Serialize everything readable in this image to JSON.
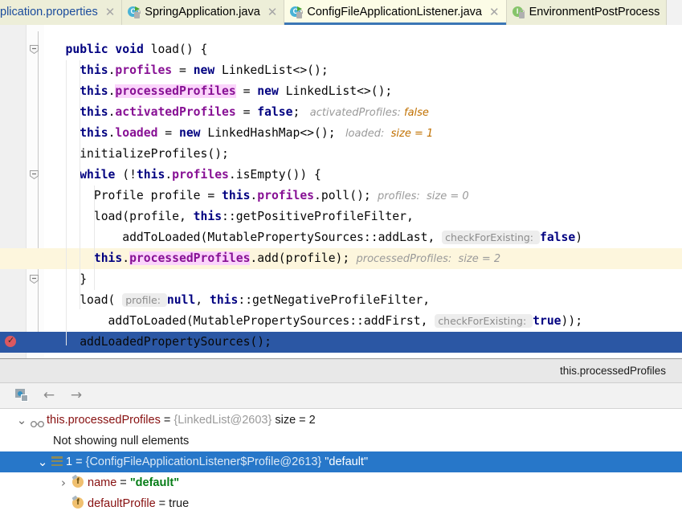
{
  "tabs": [
    {
      "label": "plication.properties",
      "icon": "properties-file-icon",
      "active": false,
      "modified": true,
      "partial": true
    },
    {
      "label": "SpringApplication.java",
      "icon": "java-class-icon",
      "active": false
    },
    {
      "label": "ConfigFileApplicationListener.java",
      "icon": "java-class-icon",
      "active": true
    },
    {
      "label": "EnvironmentPostProcess",
      "icon": "java-interface-icon",
      "active": false
    }
  ],
  "tab_close_glyph": "✕",
  "editor": {
    "lines": [
      {
        "indent": 3,
        "state": "normal",
        "tokens": [
          {
            "t": "kw",
            "v": "public"
          },
          {
            "t": "pln",
            "v": " "
          },
          {
            "t": "kw",
            "v": "void"
          },
          {
            "t": "pln",
            "v": " load() {"
          }
        ]
      },
      {
        "indent": 5,
        "state": "normal",
        "tokens": [
          {
            "t": "kw",
            "v": "this"
          },
          {
            "t": "pln",
            "v": "."
          },
          {
            "t": "fld",
            "v": "profiles"
          },
          {
            "t": "pln",
            "v": " = "
          },
          {
            "t": "kw",
            "v": "new"
          },
          {
            "t": "pln",
            "v": " LinkedList<>();"
          }
        ]
      },
      {
        "indent": 5,
        "state": "normal",
        "tokens": [
          {
            "t": "kw",
            "v": "this"
          },
          {
            "t": "pln",
            "v": "."
          },
          {
            "t": "fld-hl",
            "v": "processedProfiles"
          },
          {
            "t": "pln",
            "v": " = "
          },
          {
            "t": "kw",
            "v": "new"
          },
          {
            "t": "pln",
            "v": " LinkedList<>();"
          }
        ]
      },
      {
        "indent": 5,
        "state": "normal",
        "tokens": [
          {
            "t": "kw",
            "v": "this"
          },
          {
            "t": "pln",
            "v": "."
          },
          {
            "t": "fld",
            "v": "activatedProfiles"
          },
          {
            "t": "pln",
            "v": " = "
          },
          {
            "t": "kw",
            "v": "false"
          },
          {
            "t": "pln",
            "v": ";"
          },
          {
            "t": "hint",
            "v": "   activatedProfiles: "
          },
          {
            "t": "hintv",
            "v": "false"
          }
        ]
      },
      {
        "indent": 5,
        "state": "normal",
        "tokens": [
          {
            "t": "kw",
            "v": "this"
          },
          {
            "t": "pln",
            "v": "."
          },
          {
            "t": "fld",
            "v": "loaded"
          },
          {
            "t": "pln",
            "v": " = "
          },
          {
            "t": "kw",
            "v": "new"
          },
          {
            "t": "pln",
            "v": " LinkedHashMap<>();"
          },
          {
            "t": "hint",
            "v": "   loaded:  "
          },
          {
            "t": "hintv",
            "v": "size = 1"
          }
        ]
      },
      {
        "indent": 5,
        "state": "normal",
        "tokens": [
          {
            "t": "pln",
            "v": "initializeProfiles();"
          }
        ]
      },
      {
        "indent": 5,
        "state": "normal",
        "tokens": [
          {
            "t": "kw",
            "v": "while"
          },
          {
            "t": "pln",
            "v": " (!"
          },
          {
            "t": "kw",
            "v": "this"
          },
          {
            "t": "pln",
            "v": "."
          },
          {
            "t": "fld",
            "v": "profiles"
          },
          {
            "t": "pln",
            "v": ".isEmpty()) {"
          }
        ]
      },
      {
        "indent": 7,
        "state": "normal",
        "tokens": [
          {
            "t": "pln",
            "v": "Profile profile = "
          },
          {
            "t": "kw",
            "v": "this"
          },
          {
            "t": "pln",
            "v": "."
          },
          {
            "t": "fld",
            "v": "profiles"
          },
          {
            "t": "pln",
            "v": ".poll();"
          },
          {
            "t": "hint",
            "v": "  profiles:  "
          },
          {
            "t": "hintg",
            "v": "size = 0"
          }
        ]
      },
      {
        "indent": 7,
        "state": "normal",
        "tokens": [
          {
            "t": "pln",
            "v": "load(profile, "
          },
          {
            "t": "kw",
            "v": "this"
          },
          {
            "t": "pln",
            "v": "::getPositiveProfileFilter,"
          }
        ]
      },
      {
        "indent": 11,
        "state": "normal",
        "tokens": [
          {
            "t": "pln",
            "v": "addToLoaded(MutablePropertySources::addLast, "
          },
          {
            "t": "pbox",
            "v": "checkForExisting: ",
            "bval": "false"
          },
          {
            "t": "pln",
            "v": ")"
          }
        ]
      },
      {
        "indent": 7,
        "state": "highlight",
        "tokens": [
          {
            "t": "kw",
            "v": "this"
          },
          {
            "t": "pln",
            "v": "."
          },
          {
            "t": "fld-hl2",
            "v": "processedProfiles"
          },
          {
            "t": "pln",
            "v": ".add(profile);"
          },
          {
            "t": "hint",
            "v": "  processedProfiles:  "
          },
          {
            "t": "hintg",
            "v": "size = 2"
          }
        ]
      },
      {
        "indent": 5,
        "state": "normal",
        "tokens": [
          {
            "t": "pln",
            "v": "}"
          }
        ]
      },
      {
        "indent": 5,
        "state": "normal",
        "tokens": [
          {
            "t": "pln",
            "v": "load( "
          },
          {
            "t": "pbox2",
            "v": "profile: "
          },
          {
            "t": "kw",
            "v": "null"
          },
          {
            "t": "pln",
            "v": ", "
          },
          {
            "t": "kw",
            "v": "this"
          },
          {
            "t": "pln",
            "v": "::getNegativeProfileFilter,"
          }
        ]
      },
      {
        "indent": 9,
        "state": "normal",
        "tokens": [
          {
            "t": "pln",
            "v": "addToLoaded(MutablePropertySources::addFirst, "
          },
          {
            "t": "pbox",
            "v": "checkForExisting: ",
            "bval": "true"
          },
          {
            "t": "pln",
            "v": "));"
          }
        ]
      },
      {
        "indent": 5,
        "state": "exec",
        "tokens": [
          {
            "t": "pln",
            "v": "addLoadedPropertySources();"
          }
        ]
      }
    ],
    "fold_markers": [
      {
        "line": 0,
        "type": "fold-collapse"
      },
      {
        "line": 6,
        "type": "fold-collapse"
      },
      {
        "line": 11,
        "type": "fold-end"
      }
    ],
    "breakpoint": {
      "line": 14,
      "icon": "breakpoint-verified-icon"
    }
  },
  "popup": {
    "title": "this.processedProfiles",
    "toolbar": {
      "evaluate_icon": "evaluate-expression-icon",
      "back_icon": "arrow-left-icon",
      "back_glyph": "←",
      "forward_icon": "arrow-right-icon",
      "forward_glyph": "→"
    },
    "tree": [
      {
        "indent": 0,
        "chevron": "˅",
        "icon": "watches-icon",
        "selected": false,
        "name": "this.processedProfiles",
        "eq": " = ",
        "type": "{LinkedList@2603}",
        "suffix": "  size = 2"
      },
      {
        "indent": 1,
        "chevron": "",
        "icon": "",
        "selected": false,
        "note": "Not showing null elements"
      },
      {
        "indent": 1,
        "chevron": "˅",
        "icon": "list-element-icon",
        "selected": true,
        "name": "1",
        "eq": " = ",
        "type": "{ConfigFileApplicationListener$Profile@2613}",
        "strval": "\"default\""
      },
      {
        "indent": 2,
        "chevron": "›",
        "icon": "field-icon",
        "selected": false,
        "name": "name",
        "eq": " = ",
        "strval": "\"default\""
      },
      {
        "indent": 2,
        "chevron": "",
        "icon": "field-icon",
        "selected": false,
        "name": "defaultProfile",
        "eq": " = ",
        "plain": "true"
      }
    ]
  },
  "colors": {
    "accent": "#2b57a4",
    "selection": "#2777c9",
    "keyword": "#000080",
    "field": "#871094",
    "string": "#067d17",
    "hint_value": "#c07000",
    "breakpoint": "#db5860",
    "tab_active_bg": "#fcfce6",
    "tab_inactive_bg": "#edeed8"
  }
}
